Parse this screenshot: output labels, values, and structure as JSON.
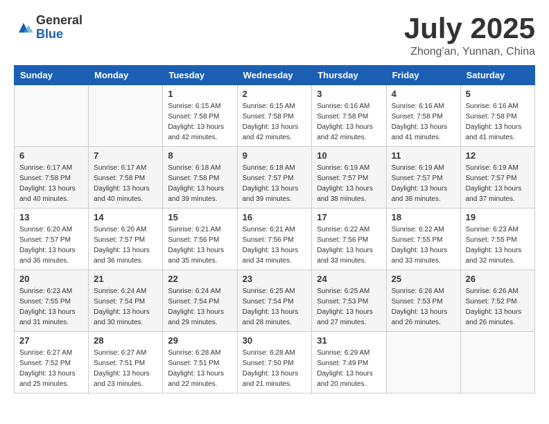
{
  "header": {
    "logo_general": "General",
    "logo_blue": "Blue",
    "month_year": "July 2025",
    "location": "Zhong'an, Yunnan, China"
  },
  "calendar": {
    "days_of_week": [
      "Sunday",
      "Monday",
      "Tuesday",
      "Wednesday",
      "Thursday",
      "Friday",
      "Saturday"
    ],
    "weeks": [
      [
        {
          "day": "",
          "detail": ""
        },
        {
          "day": "",
          "detail": ""
        },
        {
          "day": "1",
          "detail": "Sunrise: 6:15 AM\nSunset: 7:58 PM\nDaylight: 13 hours and 42 minutes."
        },
        {
          "day": "2",
          "detail": "Sunrise: 6:15 AM\nSunset: 7:58 PM\nDaylight: 13 hours and 42 minutes."
        },
        {
          "day": "3",
          "detail": "Sunrise: 6:16 AM\nSunset: 7:58 PM\nDaylight: 13 hours and 42 minutes."
        },
        {
          "day": "4",
          "detail": "Sunrise: 6:16 AM\nSunset: 7:58 PM\nDaylight: 13 hours and 41 minutes."
        },
        {
          "day": "5",
          "detail": "Sunrise: 6:16 AM\nSunset: 7:58 PM\nDaylight: 13 hours and 41 minutes."
        }
      ],
      [
        {
          "day": "6",
          "detail": "Sunrise: 6:17 AM\nSunset: 7:58 PM\nDaylight: 13 hours and 40 minutes."
        },
        {
          "day": "7",
          "detail": "Sunrise: 6:17 AM\nSunset: 7:58 PM\nDaylight: 13 hours and 40 minutes."
        },
        {
          "day": "8",
          "detail": "Sunrise: 6:18 AM\nSunset: 7:58 PM\nDaylight: 13 hours and 39 minutes."
        },
        {
          "day": "9",
          "detail": "Sunrise: 6:18 AM\nSunset: 7:57 PM\nDaylight: 13 hours and 39 minutes."
        },
        {
          "day": "10",
          "detail": "Sunrise: 6:19 AM\nSunset: 7:57 PM\nDaylight: 13 hours and 38 minutes."
        },
        {
          "day": "11",
          "detail": "Sunrise: 6:19 AM\nSunset: 7:57 PM\nDaylight: 13 hours and 38 minutes."
        },
        {
          "day": "12",
          "detail": "Sunrise: 6:19 AM\nSunset: 7:57 PM\nDaylight: 13 hours and 37 minutes."
        }
      ],
      [
        {
          "day": "13",
          "detail": "Sunrise: 6:20 AM\nSunset: 7:57 PM\nDaylight: 13 hours and 36 minutes."
        },
        {
          "day": "14",
          "detail": "Sunrise: 6:20 AM\nSunset: 7:57 PM\nDaylight: 13 hours and 36 minutes."
        },
        {
          "day": "15",
          "detail": "Sunrise: 6:21 AM\nSunset: 7:56 PM\nDaylight: 13 hours and 35 minutes."
        },
        {
          "day": "16",
          "detail": "Sunrise: 6:21 AM\nSunset: 7:56 PM\nDaylight: 13 hours and 34 minutes."
        },
        {
          "day": "17",
          "detail": "Sunrise: 6:22 AM\nSunset: 7:56 PM\nDaylight: 13 hours and 33 minutes."
        },
        {
          "day": "18",
          "detail": "Sunrise: 6:22 AM\nSunset: 7:55 PM\nDaylight: 13 hours and 33 minutes."
        },
        {
          "day": "19",
          "detail": "Sunrise: 6:23 AM\nSunset: 7:55 PM\nDaylight: 13 hours and 32 minutes."
        }
      ],
      [
        {
          "day": "20",
          "detail": "Sunrise: 6:23 AM\nSunset: 7:55 PM\nDaylight: 13 hours and 31 minutes."
        },
        {
          "day": "21",
          "detail": "Sunrise: 6:24 AM\nSunset: 7:54 PM\nDaylight: 13 hours and 30 minutes."
        },
        {
          "day": "22",
          "detail": "Sunrise: 6:24 AM\nSunset: 7:54 PM\nDaylight: 13 hours and 29 minutes."
        },
        {
          "day": "23",
          "detail": "Sunrise: 6:25 AM\nSunset: 7:54 PM\nDaylight: 13 hours and 28 minutes."
        },
        {
          "day": "24",
          "detail": "Sunrise: 6:25 AM\nSunset: 7:53 PM\nDaylight: 13 hours and 27 minutes."
        },
        {
          "day": "25",
          "detail": "Sunrise: 6:26 AM\nSunset: 7:53 PM\nDaylight: 13 hours and 26 minutes."
        },
        {
          "day": "26",
          "detail": "Sunrise: 6:26 AM\nSunset: 7:52 PM\nDaylight: 13 hours and 26 minutes."
        }
      ],
      [
        {
          "day": "27",
          "detail": "Sunrise: 6:27 AM\nSunset: 7:52 PM\nDaylight: 13 hours and 25 minutes."
        },
        {
          "day": "28",
          "detail": "Sunrise: 6:27 AM\nSunset: 7:51 PM\nDaylight: 13 hours and 23 minutes."
        },
        {
          "day": "29",
          "detail": "Sunrise: 6:28 AM\nSunset: 7:51 PM\nDaylight: 13 hours and 22 minutes."
        },
        {
          "day": "30",
          "detail": "Sunrise: 6:28 AM\nSunset: 7:50 PM\nDaylight: 13 hours and 21 minutes."
        },
        {
          "day": "31",
          "detail": "Sunrise: 6:29 AM\nSunset: 7:49 PM\nDaylight: 13 hours and 20 minutes."
        },
        {
          "day": "",
          "detail": ""
        },
        {
          "day": "",
          "detail": ""
        }
      ]
    ]
  }
}
